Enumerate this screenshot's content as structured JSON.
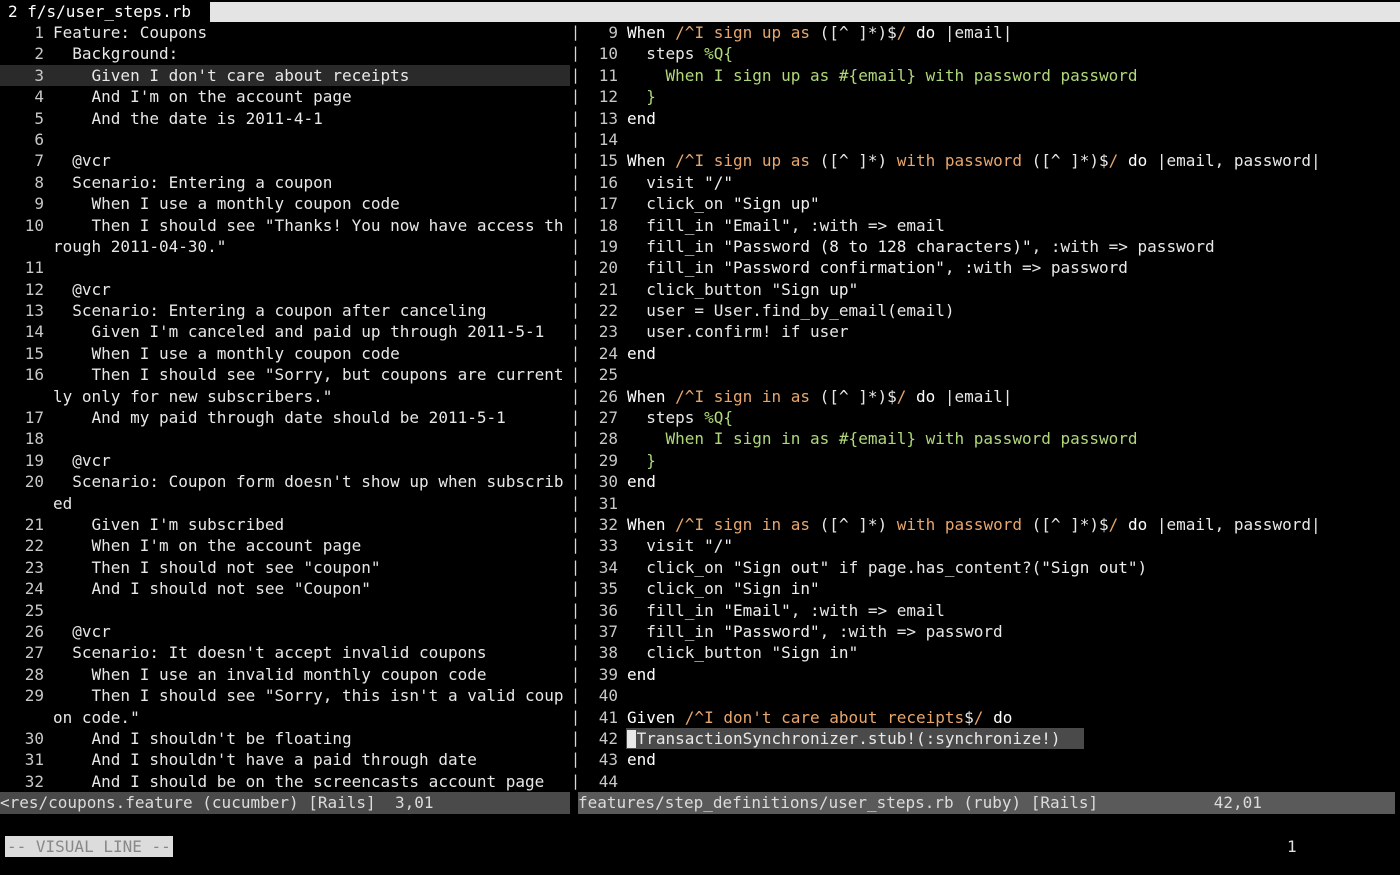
{
  "tabline": {
    "label": "2 f/s/user_steps.rb"
  },
  "left_pane": {
    "lines": [
      {
        "n": "1",
        "t": "Feature: Coupons"
      },
      {
        "n": "2",
        "t": "  Background:"
      },
      {
        "n": "3",
        "t": "    Given I don't care about receipts",
        "cursor": true
      },
      {
        "n": "4",
        "t": "    And I'm on the account page"
      },
      {
        "n": "5",
        "t": "    And the date is 2011-4-1"
      },
      {
        "n": "6",
        "t": ""
      },
      {
        "n": "7",
        "t": "  @vcr"
      },
      {
        "n": "8",
        "t": "  Scenario: Entering a coupon"
      },
      {
        "n": "9",
        "t": "    When I use a monthly coupon code"
      },
      {
        "n": "10",
        "t": "    Then I should see \"Thanks! You now have access th"
      },
      {
        "n": "",
        "t": "rough 2011-04-30.\""
      },
      {
        "n": "11",
        "t": ""
      },
      {
        "n": "12",
        "t": "  @vcr"
      },
      {
        "n": "13",
        "t": "  Scenario: Entering a coupon after canceling"
      },
      {
        "n": "14",
        "t": "    Given I'm canceled and paid up through 2011-5-1"
      },
      {
        "n": "15",
        "t": "    When I use a monthly coupon code"
      },
      {
        "n": "16",
        "t": "    Then I should see \"Sorry, but coupons are current"
      },
      {
        "n": "",
        "t": "ly only for new subscribers.\""
      },
      {
        "n": "17",
        "t": "    And my paid through date should be 2011-5-1"
      },
      {
        "n": "18",
        "t": ""
      },
      {
        "n": "19",
        "t": "  @vcr"
      },
      {
        "n": "20",
        "t": "  Scenario: Coupon form doesn't show up when subscrib"
      },
      {
        "n": "",
        "t": "ed"
      },
      {
        "n": "21",
        "t": "    Given I'm subscribed"
      },
      {
        "n": "22",
        "t": "    When I'm on the account page"
      },
      {
        "n": "23",
        "t": "    Then I should not see \"coupon\""
      },
      {
        "n": "24",
        "t": "    And I should not see \"Coupon\""
      },
      {
        "n": "25",
        "t": ""
      },
      {
        "n": "26",
        "t": "  @vcr"
      },
      {
        "n": "27",
        "t": "  Scenario: It doesn't accept invalid coupons"
      },
      {
        "n": "28",
        "t": "    When I use an invalid monthly coupon code"
      },
      {
        "n": "29",
        "t": "    Then I should see \"Sorry, this isn't a valid coup"
      },
      {
        "n": "",
        "t": "on code.\""
      },
      {
        "n": "30",
        "t": "    And I shouldn't be floating"
      },
      {
        "n": "31",
        "t": "    And I shouldn't have a paid through date"
      },
      {
        "n": "32",
        "t": "    And I should be on the screencasts account page"
      }
    ]
  },
  "right_pane": {
    "lines": [
      {
        "n": "9",
        "segs": [
          [
            "kw",
            "When "
          ],
          [
            "rx",
            "/^I sign up as "
          ],
          [
            "sym",
            "([^ ]*)$"
          ],
          [
            "rx",
            "/"
          ],
          [
            "kw",
            " do "
          ],
          [
            "sym",
            "|email|"
          ]
        ]
      },
      {
        "n": "10",
        "segs": [
          [
            "sym",
            "  steps "
          ],
          [
            "pct",
            "%Q{"
          ]
        ]
      },
      {
        "n": "11",
        "segs": [
          [
            "pct",
            "    When I sign up as #{email} with password password"
          ]
        ]
      },
      {
        "n": "12",
        "segs": [
          [
            "pct",
            "  }"
          ]
        ]
      },
      {
        "n": "13",
        "segs": [
          [
            "kw",
            "end"
          ]
        ]
      },
      {
        "n": "14",
        "segs": []
      },
      {
        "n": "15",
        "segs": [
          [
            "kw",
            "When "
          ],
          [
            "rx",
            "/^I sign up as "
          ],
          [
            "sym",
            "([^ ]*)"
          ],
          [
            "rx",
            " with password "
          ],
          [
            "sym",
            "([^ ]*)$"
          ],
          [
            "rx",
            "/"
          ],
          [
            "kw",
            " do "
          ],
          [
            "sym",
            "|email, password|"
          ]
        ]
      },
      {
        "n": "16",
        "segs": [
          [
            "sym",
            "  visit "
          ],
          [
            "str",
            "\"/\""
          ]
        ]
      },
      {
        "n": "17",
        "segs": [
          [
            "sym",
            "  click_on "
          ],
          [
            "str",
            "\"Sign up\""
          ]
        ]
      },
      {
        "n": "18",
        "segs": [
          [
            "sym",
            "  fill_in "
          ],
          [
            "str",
            "\"Email\""
          ],
          [
            "sym",
            ", :with => email"
          ]
        ]
      },
      {
        "n": "19",
        "segs": [
          [
            "sym",
            "  fill_in "
          ],
          [
            "str",
            "\"Password (8 to 128 characters)\""
          ],
          [
            "sym",
            ", :with => password"
          ]
        ]
      },
      {
        "n": "20",
        "segs": [
          [
            "sym",
            "  fill_in "
          ],
          [
            "str",
            "\"Password confirmation\""
          ],
          [
            "sym",
            ", :with => password"
          ]
        ]
      },
      {
        "n": "21",
        "segs": [
          [
            "sym",
            "  click_button "
          ],
          [
            "str",
            "\"Sign up\""
          ]
        ]
      },
      {
        "n": "22",
        "segs": [
          [
            "sym",
            "  user = User.find_by_email(email)"
          ]
        ]
      },
      {
        "n": "23",
        "segs": [
          [
            "sym",
            "  user.confirm! if user"
          ]
        ]
      },
      {
        "n": "24",
        "segs": [
          [
            "kw",
            "end"
          ]
        ]
      },
      {
        "n": "25",
        "segs": []
      },
      {
        "n": "26",
        "segs": [
          [
            "kw",
            "When "
          ],
          [
            "rx",
            "/^I sign in as "
          ],
          [
            "sym",
            "([^ ]*)$"
          ],
          [
            "rx",
            "/"
          ],
          [
            "kw",
            " do "
          ],
          [
            "sym",
            "|email|"
          ]
        ]
      },
      {
        "n": "27",
        "segs": [
          [
            "sym",
            "  steps "
          ],
          [
            "pct",
            "%Q{"
          ]
        ]
      },
      {
        "n": "28",
        "segs": [
          [
            "pct",
            "    When I sign in as #{email} with password password"
          ]
        ]
      },
      {
        "n": "29",
        "segs": [
          [
            "pct",
            "  }"
          ]
        ]
      },
      {
        "n": "30",
        "segs": [
          [
            "kw",
            "end"
          ]
        ]
      },
      {
        "n": "31",
        "segs": []
      },
      {
        "n": "32",
        "segs": [
          [
            "kw",
            "When "
          ],
          [
            "rx",
            "/^I sign in as "
          ],
          [
            "sym",
            "([^ ]*)"
          ],
          [
            "rx",
            " with password "
          ],
          [
            "sym",
            "([^ ]*)$"
          ],
          [
            "rx",
            "/"
          ],
          [
            "kw",
            " do "
          ],
          [
            "sym",
            "|email, password|"
          ]
        ]
      },
      {
        "n": "33",
        "segs": [
          [
            "sym",
            "  visit "
          ],
          [
            "str",
            "\"/\""
          ]
        ]
      },
      {
        "n": "34",
        "segs": [
          [
            "sym",
            "  click_on "
          ],
          [
            "str",
            "\"Sign out\""
          ],
          [
            "sym",
            " if page.has_content?("
          ],
          [
            "str",
            "\"Sign out\""
          ],
          [
            "sym",
            ")"
          ]
        ]
      },
      {
        "n": "35",
        "segs": [
          [
            "sym",
            "  click_on "
          ],
          [
            "str",
            "\"Sign in\""
          ]
        ]
      },
      {
        "n": "36",
        "segs": [
          [
            "sym",
            "  fill_in "
          ],
          [
            "str",
            "\"Email\""
          ],
          [
            "sym",
            ", :with => email"
          ]
        ]
      },
      {
        "n": "37",
        "segs": [
          [
            "sym",
            "  fill_in "
          ],
          [
            "str",
            "\"Password\""
          ],
          [
            "sym",
            ", :with => password"
          ]
        ]
      },
      {
        "n": "38",
        "segs": [
          [
            "sym",
            "  click_button "
          ],
          [
            "str",
            "\"Sign in\""
          ]
        ]
      },
      {
        "n": "39",
        "segs": [
          [
            "kw",
            "end"
          ]
        ]
      },
      {
        "n": "40",
        "segs": []
      },
      {
        "n": "41",
        "segs": [
          [
            "kw",
            "Given "
          ],
          [
            "rx",
            "/^I don't care about receipts"
          ],
          [
            "sym",
            "$"
          ],
          [
            "rx",
            "/"
          ],
          [
            "kw",
            " do"
          ]
        ]
      },
      {
        "n": "42",
        "segs": [
          [
            "sym",
            " TransactionSynchronizer.stub!(:synchronize!)"
          ]
        ],
        "visual": true
      },
      {
        "n": "43",
        "segs": [
          [
            "kw",
            "end"
          ]
        ]
      },
      {
        "n": "44",
        "segs": []
      }
    ]
  },
  "status_left": "<res/coupons.feature (cucumber) [Rails]  3,01",
  "status_right": "features/step_definitions/user_steps.rb (ruby) [Rails]            42,01",
  "mode": "-- VISUAL LINE --",
  "count": "1"
}
